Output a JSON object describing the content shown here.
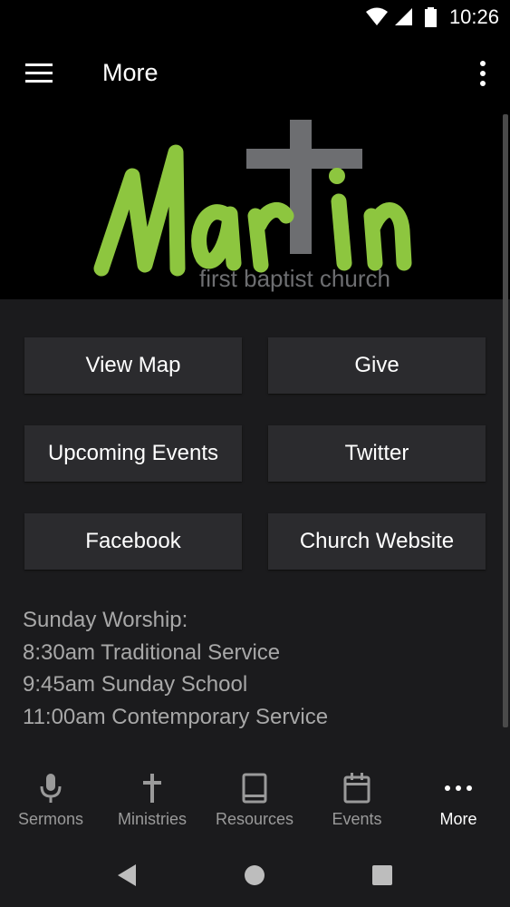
{
  "status_bar": {
    "time": "10:26",
    "icons": [
      "wifi-icon",
      "cell-signal-icon",
      "battery-icon"
    ]
  },
  "app_bar": {
    "title": "More",
    "menu_icon": "hamburger-menu-icon",
    "overflow_icon": "more-vert-icon"
  },
  "banner": {
    "logo_word": "Martin",
    "logo_subtitle": "first baptist church",
    "colors": {
      "green": "#8dc63f",
      "gray": "#6d6e71"
    }
  },
  "buttons": [
    {
      "label": "View Map"
    },
    {
      "label": "Give"
    },
    {
      "label": "Upcoming Events"
    },
    {
      "label": "Twitter"
    },
    {
      "label": "Facebook"
    },
    {
      "label": "Church Website"
    }
  ],
  "worship": {
    "heading": "Sunday Worship:",
    "lines": [
      "8:30am Traditional Service",
      "9:45am Sunday School",
      "11:00am Contemporary Service"
    ]
  },
  "bottom_nav": {
    "items": [
      {
        "label": "Sermons",
        "icon": "microphone-icon"
      },
      {
        "label": "Ministries",
        "icon": "cross-icon"
      },
      {
        "label": "Resources",
        "icon": "book-icon"
      },
      {
        "label": "Events",
        "icon": "calendar-icon"
      },
      {
        "label": "More",
        "icon": "more-horiz-icon"
      }
    ],
    "active": "More"
  },
  "system_nav": {
    "icons": [
      "back-icon",
      "home-icon",
      "recents-icon"
    ]
  }
}
